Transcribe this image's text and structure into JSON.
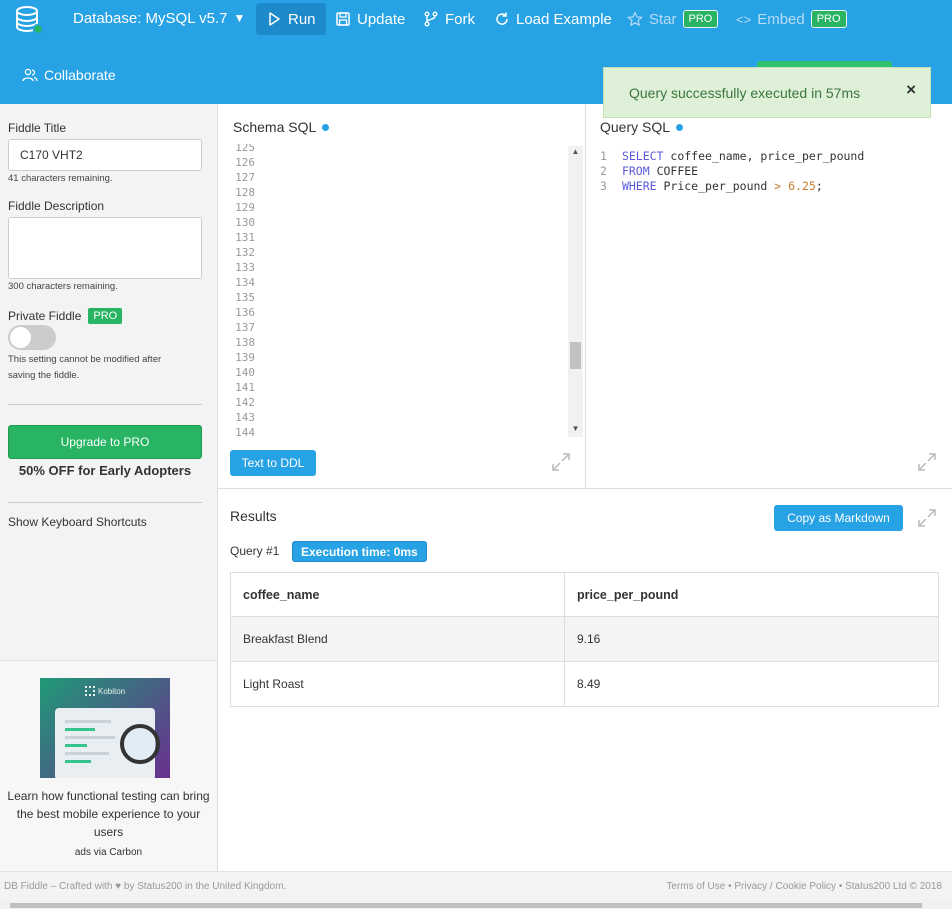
{
  "header": {
    "database_label": "Database: MySQL v5.7",
    "run": "Run",
    "update": "Update",
    "fork": "Fork",
    "load_example": "Load Example",
    "star": "Star",
    "embed": "Embed",
    "pro_badge": "PRO",
    "collaborate": "Collaborate"
  },
  "toast": {
    "message": "Query successfully executed in 57ms",
    "close": "×"
  },
  "sidebar": {
    "title_label": "Fiddle Title",
    "title_value": "C170 VHT2",
    "title_remaining": "41 characters remaining.",
    "description_label": "Fiddle Description",
    "description_remaining": "300 characters remaining.",
    "private_label": "Private Fiddle",
    "private_note_1": "This setting cannot be modified after",
    "private_note_2": "saving the fiddle.",
    "upgrade_button": "Upgrade to PRO",
    "discount": "50% OFF for Early Adopters",
    "shortcuts": "Show Keyboard Shortcuts",
    "ad_brand": "Kobiton",
    "ad_text": "Learn how functional testing can bring the best mobile experience to your users",
    "ad_via": "ads via Carbon"
  },
  "schema": {
    "title": "Schema SQL",
    "line_numbers": [
      "125",
      "126",
      "127",
      "128",
      "129",
      "130",
      "131",
      "132",
      "133",
      "134",
      "135",
      "136",
      "137",
      "138",
      "139",
      "140",
      "141",
      "142",
      "143",
      "144"
    ],
    "text_to_ddl": "Text to DDL"
  },
  "query": {
    "title": "Query SQL",
    "lines": [
      {
        "n": "1",
        "kw": "SELECT",
        "rest": " coffee_name, price_per_pound"
      },
      {
        "n": "2",
        "kw": "FROM",
        "rest": " COFFEE"
      },
      {
        "n": "3",
        "kw": "WHERE",
        "rest": " Price_per_pound ",
        "op": ">",
        "num": " 6.25",
        "end": ";"
      }
    ]
  },
  "results": {
    "title": "Results",
    "copy_markdown": "Copy as Markdown",
    "query_label": "Query #1",
    "execution_time": "Execution time: 0ms",
    "columns": [
      "coffee_name",
      "price_per_pound"
    ],
    "rows": [
      [
        "Breakfast Blend",
        "9.16"
      ],
      [
        "Light Roast",
        "8.49"
      ]
    ]
  },
  "footer": {
    "left": "DB Fiddle – Crafted with ♥ by Status200 in the United Kingdom.",
    "right": "Terms of Use • Privacy / Cookie Policy • Status200 Ltd © 2018"
  },
  "colors": {
    "header_bg": "#26a2e5",
    "pro_green": "#28b463",
    "toast_bg": "#def0d8"
  }
}
